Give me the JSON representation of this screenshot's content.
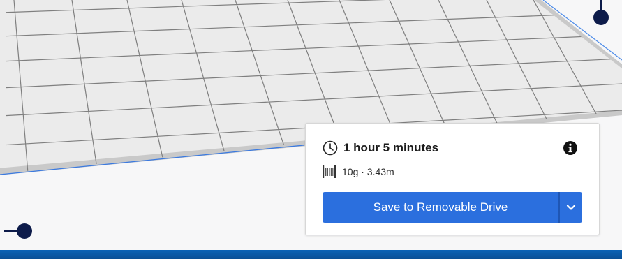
{
  "print_estimate": {
    "time": "1 hour 5 minutes",
    "material": "10g · 3.43m"
  },
  "actions": {
    "save_label": "Save to Removable Drive"
  },
  "icons": {
    "clock": "clock-icon",
    "info": "info-icon",
    "filament": "filament-spool-icon",
    "dropdown": "chevron-down-icon"
  },
  "colors": {
    "accent": "#2b6fde",
    "build_plate": "#ececec",
    "grid_lines": "#7d7d7d",
    "handle": "#0d1b4a"
  }
}
